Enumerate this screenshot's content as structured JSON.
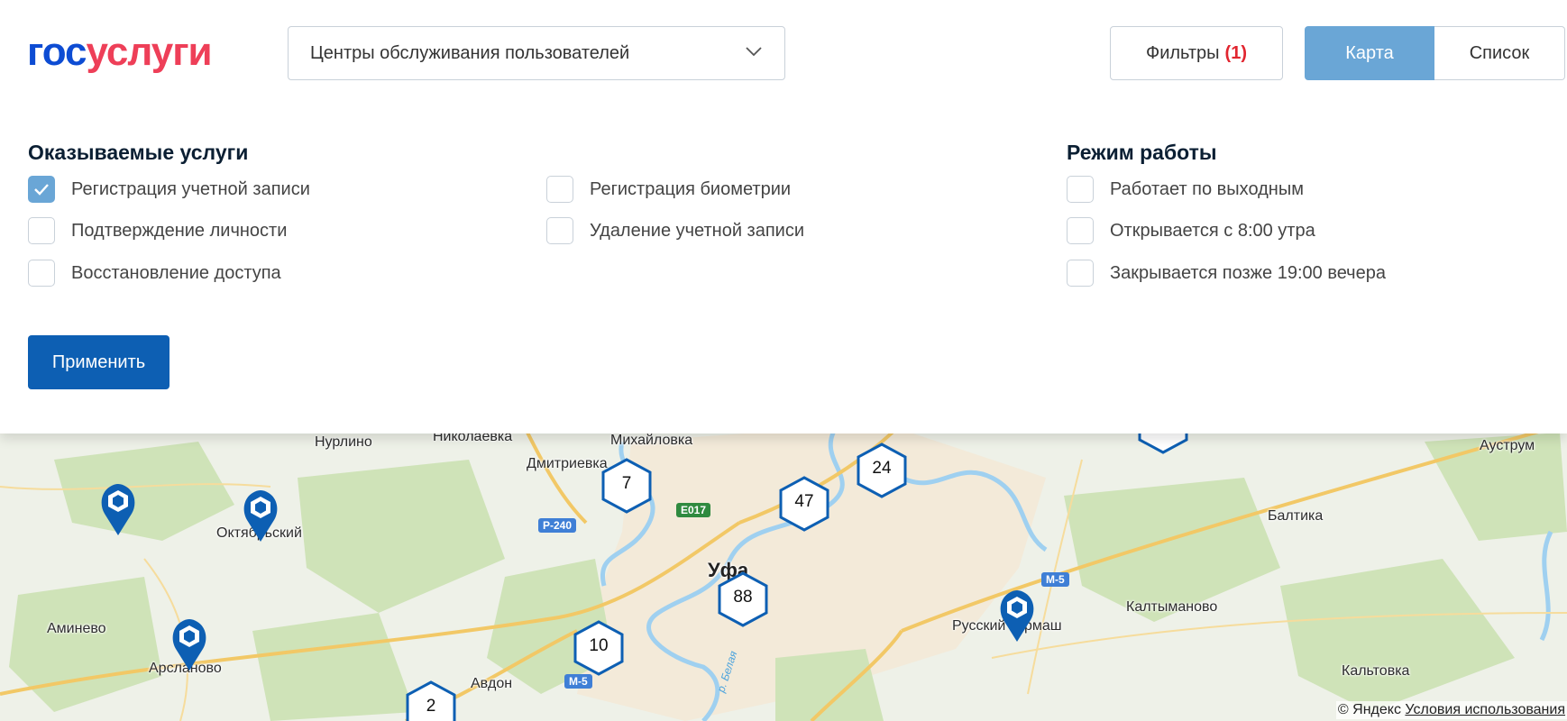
{
  "header": {
    "logo_part1": "гос",
    "logo_part2": "услуги",
    "dropdown_value": "Центры обслуживания пользователей",
    "filters_label": "Фильтры",
    "filters_count": "(1)",
    "view_toggle": {
      "map_label": "Карта",
      "list_label": "Список",
      "active": "Карта"
    }
  },
  "filters": {
    "services_title": "Оказываемые услуги",
    "services": [
      {
        "label": "Регистрация учетной записи",
        "checked": true
      },
      {
        "label": "Подтверждение личности",
        "checked": false
      },
      {
        "label": "Восстановление доступа",
        "checked": false
      },
      {
        "label": "Регистрация биометрии",
        "checked": false
      },
      {
        "label": "Удаление учетной записи",
        "checked": false
      }
    ],
    "hours_title": "Режим работы",
    "hours": [
      {
        "label": "Работает по выходным",
        "checked": false
      },
      {
        "label": "Открывается с 8:00 утра",
        "checked": false
      },
      {
        "label": "Закрывается позже 19:00 вечера",
        "checked": false
      }
    ],
    "apply_label": "Применить"
  },
  "map": {
    "city": "Уфа",
    "places": [
      "Нурлино",
      "Николаевка",
      "Михайловка",
      "Дмитриевка",
      "Ауструм",
      "Балтика",
      "Октябрьский",
      "Аминево",
      "Арсланово",
      "Авдон",
      "Русский Юрмаш",
      "Калтыманово",
      "Кальтовка"
    ],
    "roads": [
      "Р-240",
      "E017",
      "М-5",
      "М-5"
    ],
    "river_label": "р. Белая",
    "clusters": [
      "7",
      "47",
      "24",
      "88",
      "10",
      "2"
    ],
    "copyright_text": "© Яндекс",
    "terms_link": "Условия использования"
  },
  "colors": {
    "brand_blue": "#0d4cd3",
    "brand_red": "#ee3f58",
    "primary_button": "#0d5fb3",
    "active_toggle": "#6aa6d6",
    "marker_blue": "#0d5fb3"
  }
}
